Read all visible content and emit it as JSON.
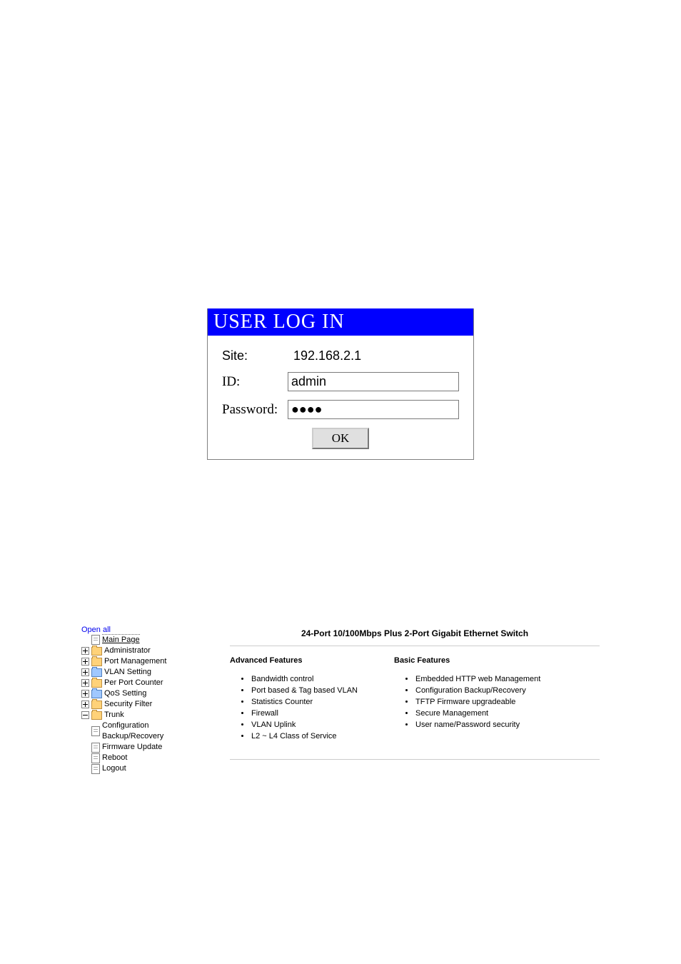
{
  "login": {
    "header": "USER LOG IN",
    "site_label": "Site:",
    "site_value": "192.168.2.1",
    "id_label": "ID:",
    "id_value": "admin",
    "password_label": "Password:",
    "password_value": "●●●●",
    "ok_button": "OK"
  },
  "tree": {
    "open_all": "Open all",
    "main_page": "Main Page",
    "items": [
      {
        "label": "Administrator",
        "folder": "yellow"
      },
      {
        "label": "Port Management",
        "folder": "yellow"
      },
      {
        "label": "VLAN Setting",
        "folder": "blue"
      },
      {
        "label": "Per Port Counter",
        "folder": "yellow"
      },
      {
        "label": "QoS Setting",
        "folder": "blue"
      },
      {
        "label": "Security Filter",
        "folder": "yellow"
      },
      {
        "label": "Trunk",
        "folder": "yellow"
      }
    ],
    "leaf_items": [
      {
        "label": "Configuration Backup/Recovery"
      },
      {
        "label": "Firmware Update"
      },
      {
        "label": "Reboot"
      },
      {
        "label": "Logout"
      }
    ]
  },
  "main": {
    "title": "24-Port 10/100Mbps Plus 2-Port Gigabit Ethernet Switch",
    "adv_heading": "Advanced Features",
    "basic_heading": "Basic Features",
    "advanced": [
      "Bandwidth control",
      "Port based & Tag based VLAN",
      "Statistics Counter",
      "Firewall",
      "VLAN Uplink",
      "L2 ~ L4 Class of Service"
    ],
    "basic": [
      "Embedded HTTP web Management",
      "Configuration Backup/Recovery",
      "TFTP Firmware upgradeable",
      "Secure Management",
      "User name/Password security"
    ]
  }
}
